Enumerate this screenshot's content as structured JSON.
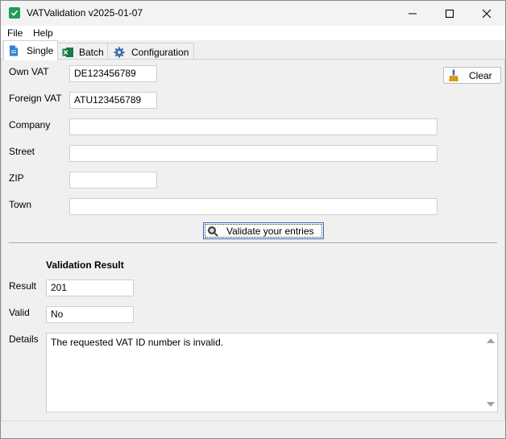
{
  "window": {
    "title": "VATValidation v2025-01-07"
  },
  "menu": {
    "file": "File",
    "help": "Help"
  },
  "tabs": [
    {
      "label": "Single",
      "active": true
    },
    {
      "label": "Batch",
      "active": false
    },
    {
      "label": "Configuration",
      "active": false
    }
  ],
  "form": {
    "own_vat": {
      "label": "Own VAT",
      "value": "DE123456789"
    },
    "foreign_vat": {
      "label": "Foreign VAT",
      "value": "ATU123456789"
    },
    "company": {
      "label": "Company",
      "value": ""
    },
    "street": {
      "label": "Street",
      "value": ""
    },
    "zip": {
      "label": "ZIP",
      "value": ""
    },
    "town": {
      "label": "Town",
      "value": ""
    },
    "clear_label": "Clear",
    "validate_label": "Validate your entries"
  },
  "result": {
    "title": "Validation Result",
    "result_label": "Result",
    "result_value": "201",
    "valid_label": "Valid",
    "valid_value": "No",
    "details_label": "Details",
    "details_value": "The requested VAT ID number is invalid."
  },
  "colors": {
    "app_icon": "#1e9e56",
    "excel_icon": "#1d7a45",
    "doc_icon": "#2f7fd6",
    "focus_border": "#2a6fbf"
  },
  "icons": {
    "app": "check-icon",
    "single_tab": "document-icon",
    "batch_tab": "excel-icon",
    "config_tab": "gear-icon",
    "clear": "broom-icon",
    "validate": "magnifier-icon"
  }
}
